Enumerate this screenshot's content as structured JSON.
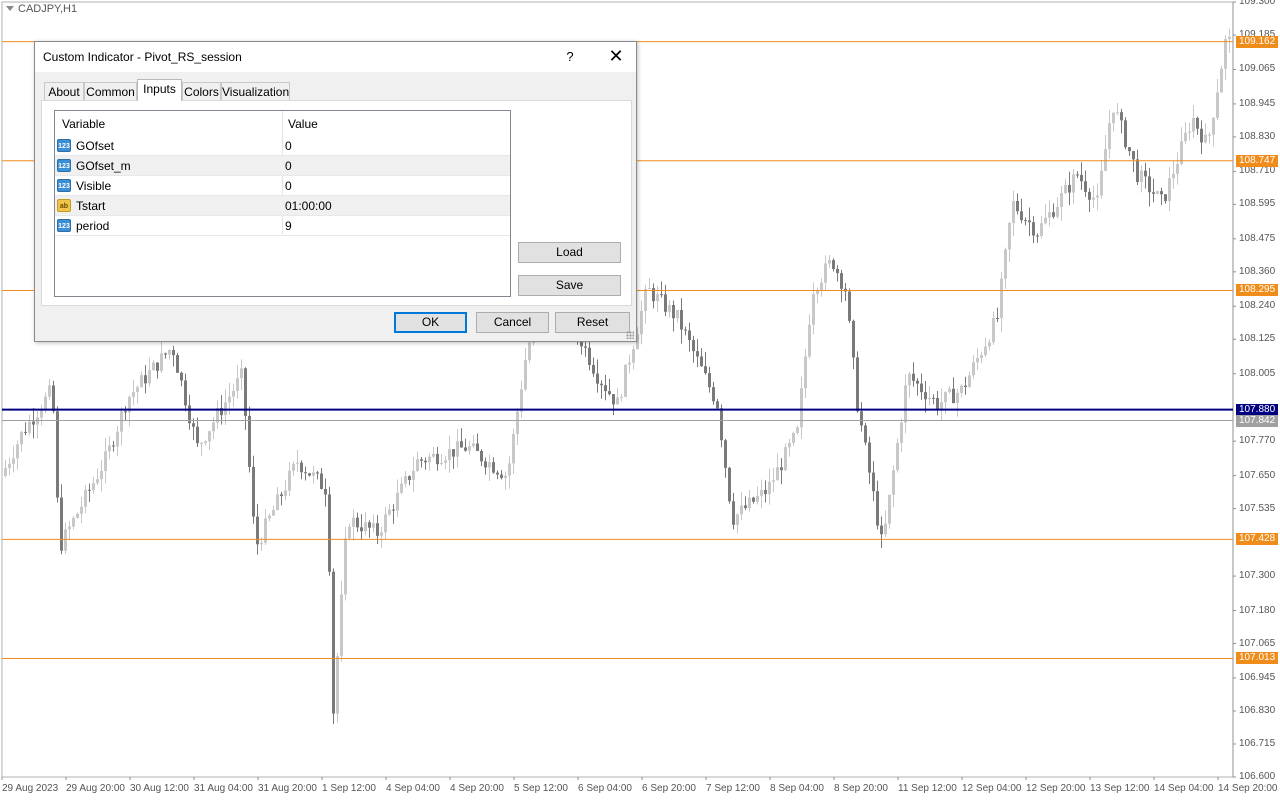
{
  "chart": {
    "symbol_label": "CADJPY,H1",
    "y_min": 106.6,
    "y_max": 109.3,
    "price_ticks": [
      "109.300",
      "109.185",
      "109.065",
      "108.945",
      "108.830",
      "108.710",
      "108.595",
      "108.475",
      "108.360",
      "108.240",
      "108.125",
      "108.005",
      "107.770",
      "107.650",
      "107.535",
      "107.300",
      "107.180",
      "107.065",
      "106.945",
      "106.830",
      "106.715",
      "106.600"
    ],
    "time_ticks": [
      "29 Aug 2023",
      "29 Aug 20:00",
      "30 Aug 12:00",
      "31 Aug 04:00",
      "31 Aug 20:00",
      "1 Sep 12:00",
      "4 Sep 04:00",
      "4 Sep 20:00",
      "5 Sep 12:00",
      "6 Sep 04:00",
      "6 Sep 20:00",
      "7 Sep 12:00",
      "8 Sep 04:00",
      "8 Sep 20:00",
      "11 Sep 12:00",
      "12 Sep 04:00",
      "12 Sep 20:00",
      "13 Sep 12:00",
      "14 Sep 04:00",
      "14 Sep 20:00"
    ],
    "levels": [
      {
        "price": 109.162,
        "label": "109.162",
        "color": "#f08c1a"
      },
      {
        "price": 108.747,
        "label": "108.747",
        "color": "#f08c1a"
      },
      {
        "price": 108.295,
        "label": "108.295",
        "color": "#f08c1a"
      },
      {
        "price": 107.88,
        "label": "107.880",
        "color": "#000080"
      },
      {
        "price": 107.842,
        "label": "107.842",
        "color": "#a0a0a0"
      },
      {
        "price": 107.428,
        "label": "107.428",
        "color": "#f08c1a"
      },
      {
        "price": 107.013,
        "label": "107.013",
        "color": "#f08c1a"
      }
    ],
    "bull_color": "#c8c8c8",
    "bear_color": "#7a7a7a"
  },
  "dialog": {
    "title": "Custom Indicator - Pivot_RS_session",
    "help_label": "?",
    "close_label": "✕",
    "tabs": [
      {
        "label": "About"
      },
      {
        "label": "Common"
      },
      {
        "label": "Inputs"
      },
      {
        "label": "Colors"
      },
      {
        "label": "Visualization"
      }
    ],
    "active_tab": "Inputs",
    "grid": {
      "col_variable": "Variable",
      "col_value": "Value",
      "rows": [
        {
          "icon": "123",
          "type": "number-icon",
          "variable": "GOfset",
          "value": "0"
        },
        {
          "icon": "123",
          "type": "number-icon",
          "variable": "GOfset_m",
          "value": "0"
        },
        {
          "icon": "123",
          "type": "number-icon",
          "variable": "Visible",
          "value": "0"
        },
        {
          "icon": "ab",
          "type": "string-icon",
          "variable": "Tstart",
          "value": "01:00:00"
        },
        {
          "icon": "123",
          "type": "number-icon",
          "variable": "period",
          "value": "9"
        }
      ]
    },
    "load_label": "Load",
    "save_label": "Save",
    "ok_label": "OK",
    "cancel_label": "Cancel",
    "reset_label": "Reset"
  }
}
